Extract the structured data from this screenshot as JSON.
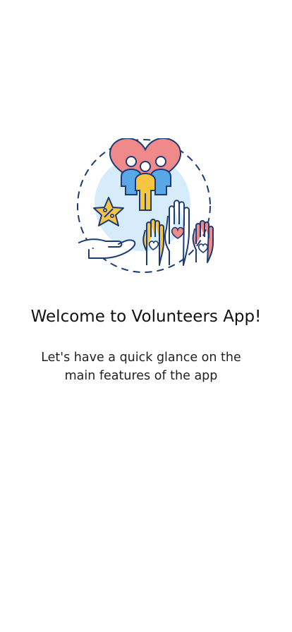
{
  "onboarding": {
    "title": "Welcome to Volunteers App!",
    "subtitle": "Let's have a quick glance on the main features of the app",
    "illustration": {
      "icon": "volunteers-hands-heart-illustration",
      "colors": {
        "outline": "#1c3a73",
        "heart": "#f08a8a",
        "blue_person": "#5aa7e8",
        "yellow_person": "#f6c542",
        "background_circle": "#d6ecfb",
        "star": "#f6c542",
        "pink_hand": "#f08a8a",
        "yellow_hand": "#f6c542",
        "white": "#ffffff"
      }
    }
  }
}
